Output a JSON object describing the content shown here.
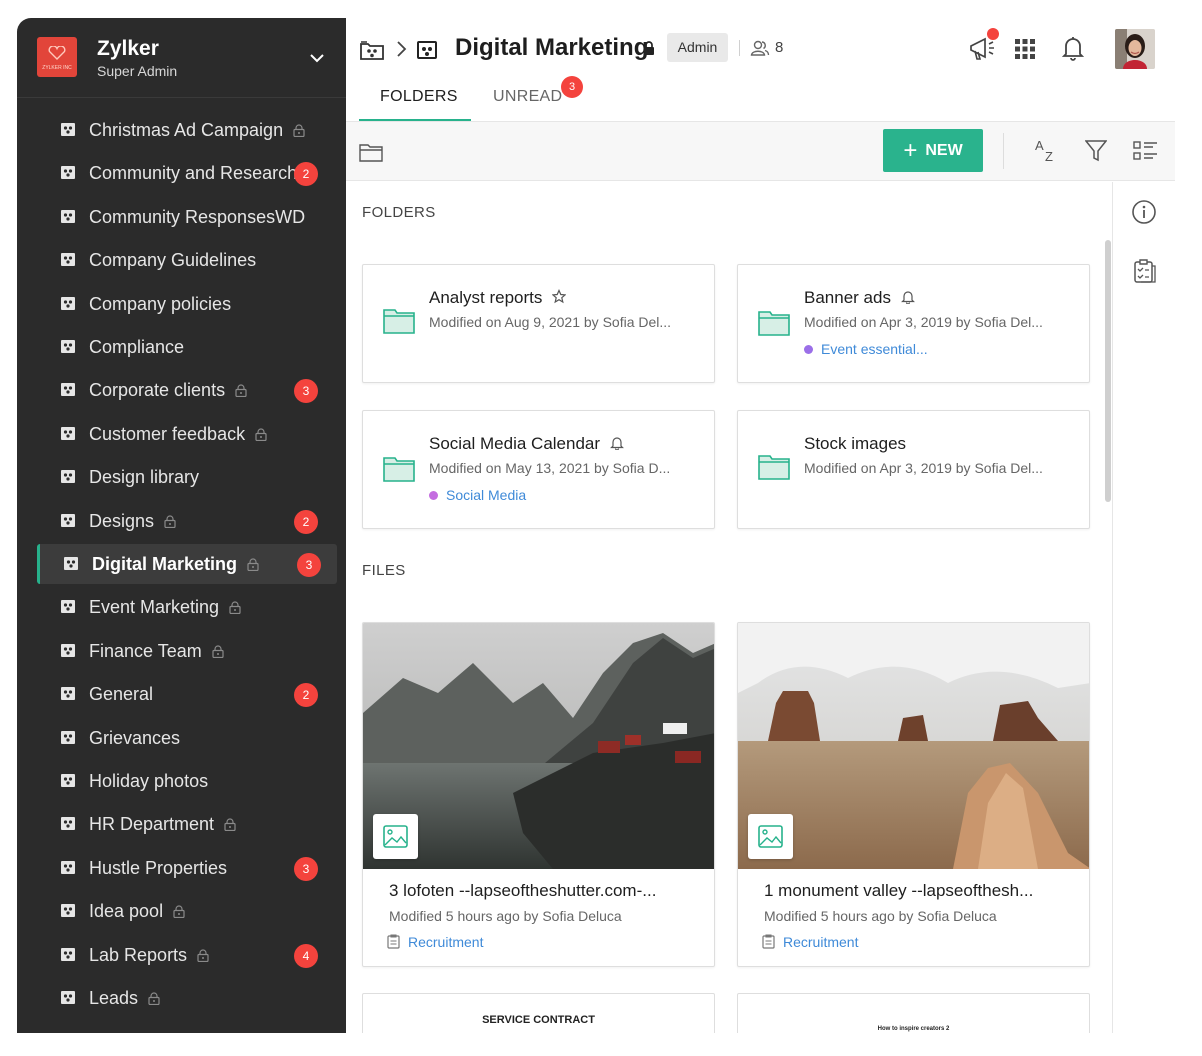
{
  "org": {
    "name": "Zylker",
    "role": "Super Admin",
    "logo_text": "ZYLKER INC"
  },
  "sidebar": {
    "items": [
      {
        "label": "Christmas Ad Campaign",
        "locked": true,
        "badge": ""
      },
      {
        "label": "Community and Research",
        "locked": false,
        "badge": "2"
      },
      {
        "label": "Community ResponsesWD",
        "locked": false,
        "badge": ""
      },
      {
        "label": "Company Guidelines",
        "locked": false,
        "badge": ""
      },
      {
        "label": "Company policies",
        "locked": false,
        "badge": ""
      },
      {
        "label": "Compliance",
        "locked": false,
        "badge": ""
      },
      {
        "label": "Corporate clients",
        "locked": true,
        "badge": "3"
      },
      {
        "label": "Customer feedback",
        "locked": true,
        "badge": ""
      },
      {
        "label": "Design library",
        "locked": false,
        "badge": ""
      },
      {
        "label": "Designs",
        "locked": true,
        "badge": "2"
      },
      {
        "label": "Digital Marketing",
        "locked": true,
        "badge": "3",
        "active": true
      },
      {
        "label": "Event Marketing",
        "locked": true,
        "badge": ""
      },
      {
        "label": "Finance Team",
        "locked": true,
        "badge": ""
      },
      {
        "label": "General",
        "locked": false,
        "badge": "2"
      },
      {
        "label": "Grievances",
        "locked": false,
        "badge": ""
      },
      {
        "label": "Holiday photos",
        "locked": false,
        "badge": ""
      },
      {
        "label": "HR Department",
        "locked": true,
        "badge": ""
      },
      {
        "label": "Hustle Properties",
        "locked": false,
        "badge": "3"
      },
      {
        "label": "Idea pool",
        "locked": true,
        "badge": ""
      },
      {
        "label": "Lab Reports",
        "locked": true,
        "badge": "4"
      },
      {
        "label": "Leads",
        "locked": true,
        "badge": ""
      }
    ]
  },
  "header": {
    "title": "Digital Marketing",
    "role_badge": "Admin",
    "members_count": "8"
  },
  "tabs": {
    "folders": "FOLDERS",
    "unread": "UNREAD",
    "unread_badge": "3"
  },
  "toolbar": {
    "new_label": "NEW",
    "sort_icon": "sort-az-icon",
    "filter_icon": "filter-icon",
    "view_icon": "list-view-icon"
  },
  "sections": {
    "folders": "FOLDERS",
    "files": "FILES"
  },
  "folders": [
    {
      "name": "Analyst reports",
      "meta": "Modified on Aug 9, 2021 by Sofia Del...",
      "tag": "",
      "tag_color": "",
      "extra_icon": "star-icon"
    },
    {
      "name": "Banner ads",
      "meta": "Modified on Apr 3, 2019 by Sofia Del...",
      "tag": "Event essential...",
      "tag_color": "#9b6fe8",
      "extra_icon": "bell-icon"
    },
    {
      "name": "Social Media Calendar",
      "meta": "Modified on May 13, 2021 by Sofia D...",
      "tag": "Social Media",
      "tag_color": "#c46de0",
      "extra_icon": "bell-icon"
    },
    {
      "name": "Stock images",
      "meta": "Modified on Apr 3, 2019 by Sofia Del...",
      "tag": "",
      "tag_color": "",
      "extra_icon": ""
    }
  ],
  "files": [
    {
      "name": "3 lofoten --lapseoftheshutter.com-...",
      "meta": "Modified 5 hours ago by Sofia Deluca",
      "tag": "Recruitment"
    },
    {
      "name": "1 monument valley --lapseofthesh...",
      "meta": "Modified 5 hours ago by Sofia Deluca",
      "tag": "Recruitment"
    }
  ],
  "docs": [
    {
      "title": "SERVICE CONTRACT"
    },
    {
      "title": "How to inspire creators 2"
    }
  ],
  "colors": {
    "accent": "#2ab38d",
    "badge": "#f4433d",
    "sidebar": "#2b2b2b",
    "tag_link": "#3f8ad8"
  }
}
